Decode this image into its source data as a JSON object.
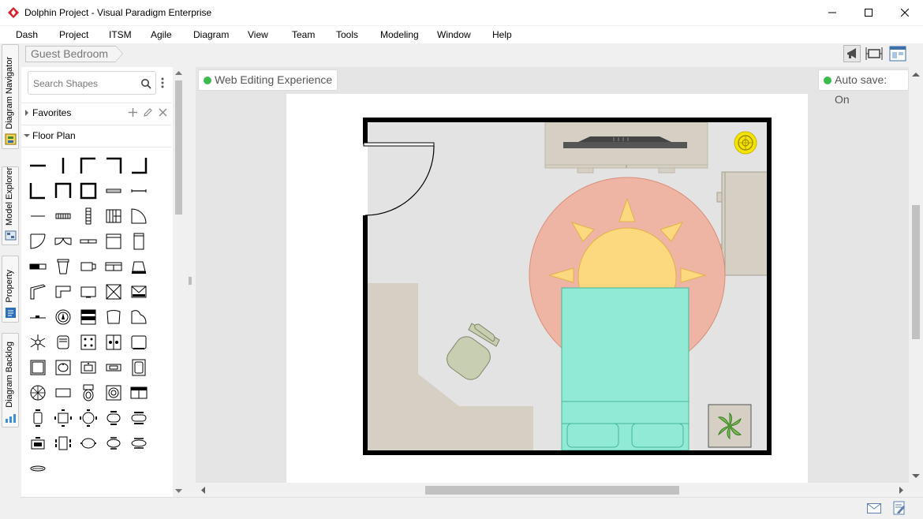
{
  "window": {
    "title": "Dolphin Project - Visual Paradigm Enterprise",
    "minimize_glyph": "—",
    "maximize_glyph": "☐",
    "close_glyph": "✕"
  },
  "menu": [
    "Dash",
    "Project",
    "ITSM",
    "Agile",
    "Diagram",
    "View",
    "Team",
    "Tools",
    "Modeling",
    "Window",
    "Help"
  ],
  "side_tabs": [
    "Diagram Navigator",
    "Model Explorer",
    "Property",
    "Diagram Backlog"
  ],
  "breadcrumb": "Guest Bedroom",
  "shapes_panel": {
    "search_placeholder": "Search Shapes",
    "sections": {
      "favorites": "Favorites",
      "floor_plan": "Floor Plan"
    }
  },
  "canvas": {
    "mode_badge": "Web Editing Experience",
    "autosave_badge": "Auto save: On"
  },
  "colors": {
    "status_green": "#3cba4c",
    "rug": "#eeb5a5",
    "sun": "#fcd97e",
    "bed": "#90ead4",
    "furniture": "#d5d0c3",
    "wall": "#000000",
    "floor": "#e3e3e3"
  }
}
